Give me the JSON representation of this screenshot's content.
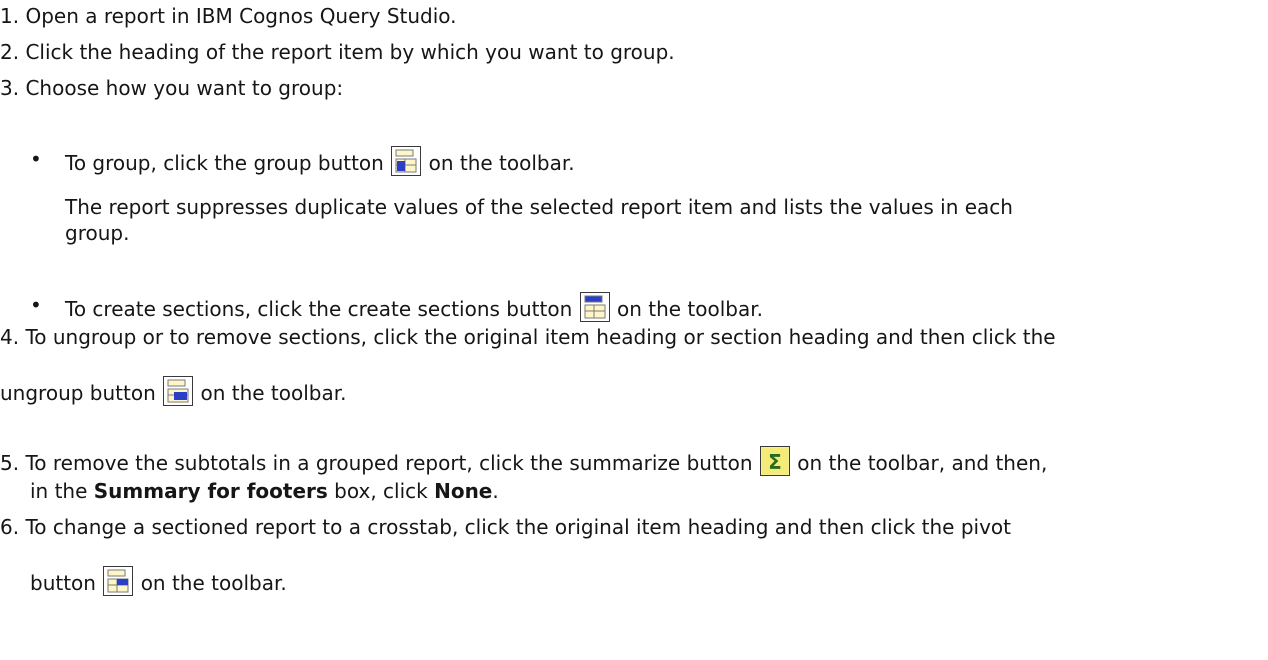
{
  "steps": {
    "s1": {
      "num": "1.",
      "text": "Open a report in IBM Cognos Query Studio."
    },
    "s2": {
      "num": "2.",
      "text": "Click the heading of the report item by which you want to group."
    },
    "s3": {
      "num": "3.",
      "text": "Choose how you want to group:",
      "bullet_a": {
        "pre": "To group, click the group button",
        "post": "on the toolbar."
      },
      "bullet_a_note_1": "The report suppresses duplicate values of the selected report item and lists the values in each",
      "bullet_a_note_2": "group.",
      "bullet_b": {
        "pre": "To create sections, click the create sections button",
        "post": "on the toolbar."
      }
    },
    "s4": {
      "num": "4.",
      "line1": "To ungroup or to remove sections, click the original item heading or section heading and then click the",
      "pre": "ungroup button",
      "post": "on the toolbar."
    },
    "s5": {
      "num": "5.",
      "line1_pre": "To remove the subtotals in a grouped report, click the summarize button",
      "line1_post": "on the toolbar, and then,",
      "line2_a": "in the",
      "line2_bold1": "Summary for footers",
      "line2_b": "box, click",
      "line2_bold2": "None",
      "line2_c": "."
    },
    "s6": {
      "num": "6.",
      "line1": "To change a sectioned report to a crosstab, click the original item heading and then click the pivot",
      "pre": "button",
      "post": "on the toolbar."
    }
  },
  "bullet_glyph": "•",
  "icons": {
    "group": "group-icon",
    "sections": "create-sections-icon",
    "ungroup": "ungroup-icon",
    "summarize": "summarize-icon",
    "pivot": "pivot-icon"
  }
}
